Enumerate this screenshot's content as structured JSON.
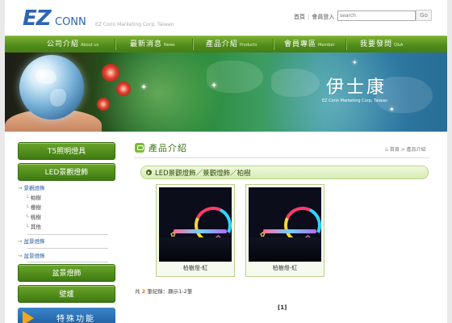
{
  "header": {
    "logo_text_ez": "EZ",
    "logo_text_conn": "CONN",
    "tagline": "EZ Conn Marketing Corp, Taiwan",
    "links": [
      "首頁",
      "會員登入"
    ],
    "search_placeholder": "search",
    "go_label": "Go"
  },
  "nav": [
    {
      "zh": "公司介紹",
      "en": "About us"
    },
    {
      "zh": "最新消息",
      "en": "News"
    },
    {
      "zh": "產品介紹",
      "en": "Products"
    },
    {
      "zh": "會員專區",
      "en": "Member"
    },
    {
      "zh": "我要發問",
      "en": "Q&A"
    }
  ],
  "banner": {
    "title": "伊士康",
    "subtitle": "EZ Conn Marketing Corp, Taiwan"
  },
  "sidebar": {
    "btn1": "T5照明燈具",
    "btn2": "LED景觀燈飾",
    "sub": {
      "main": "景觀燈飾",
      "children": [
        "柏樹",
        "櫻樹",
        "桃樹",
        "其他"
      ],
      "item2": "盆景燈飾",
      "item3": "盆景燈飾"
    },
    "btn3": "盆景燈飾",
    "btn4": "壁爐",
    "promo": "特殊功能"
  },
  "main": {
    "title": "產品介紹",
    "breadcrumb": [
      "首頁",
      "產品介紹"
    ],
    "category": "LED景觀燈飾／景觀燈飾／柏樹",
    "products": [
      {
        "caption": "柏樹燈-紅"
      },
      {
        "caption": "柏樹燈-紅"
      }
    ],
    "count_prefix": "共",
    "count_num": "2",
    "count_suffix": "筆紀錄：顯示1-2筆",
    "pager": "[1]"
  },
  "colors": {
    "nav_green": "#4f8a1c",
    "link_blue": "#2a5fa0",
    "title_green": "#3f7a16",
    "count_orange": "#e0701a"
  }
}
